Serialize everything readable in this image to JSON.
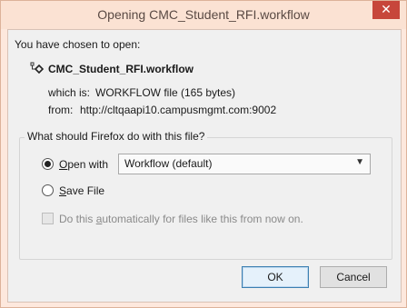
{
  "window": {
    "title": "Opening CMC_Student_RFI.workflow",
    "close_glyph": "✕"
  },
  "dialog": {
    "intro": "You have chosen to open:",
    "filename": "CMC_Student_RFI.workflow",
    "file_icon": "workflow-file-icon",
    "which_is_label": "which is:",
    "which_is_value": "WORKFLOW file (165 bytes)",
    "from_label": "from:",
    "from_value": "http://cltqaapi10.campusmgmt.com:9002"
  },
  "action_group": {
    "label": "What should Firefox do with this file?",
    "open_with": {
      "accel": "O",
      "rest": "pen with",
      "selected": true,
      "app": "Workflow (default)"
    },
    "save_file": {
      "accel": "S",
      "rest": "ave File",
      "selected": false
    },
    "auto": {
      "before": "Do this ",
      "accel": "a",
      "after": "utomatically for files like this from now on.",
      "enabled": false
    }
  },
  "buttons": {
    "ok": "OK",
    "cancel": "Cancel"
  }
}
